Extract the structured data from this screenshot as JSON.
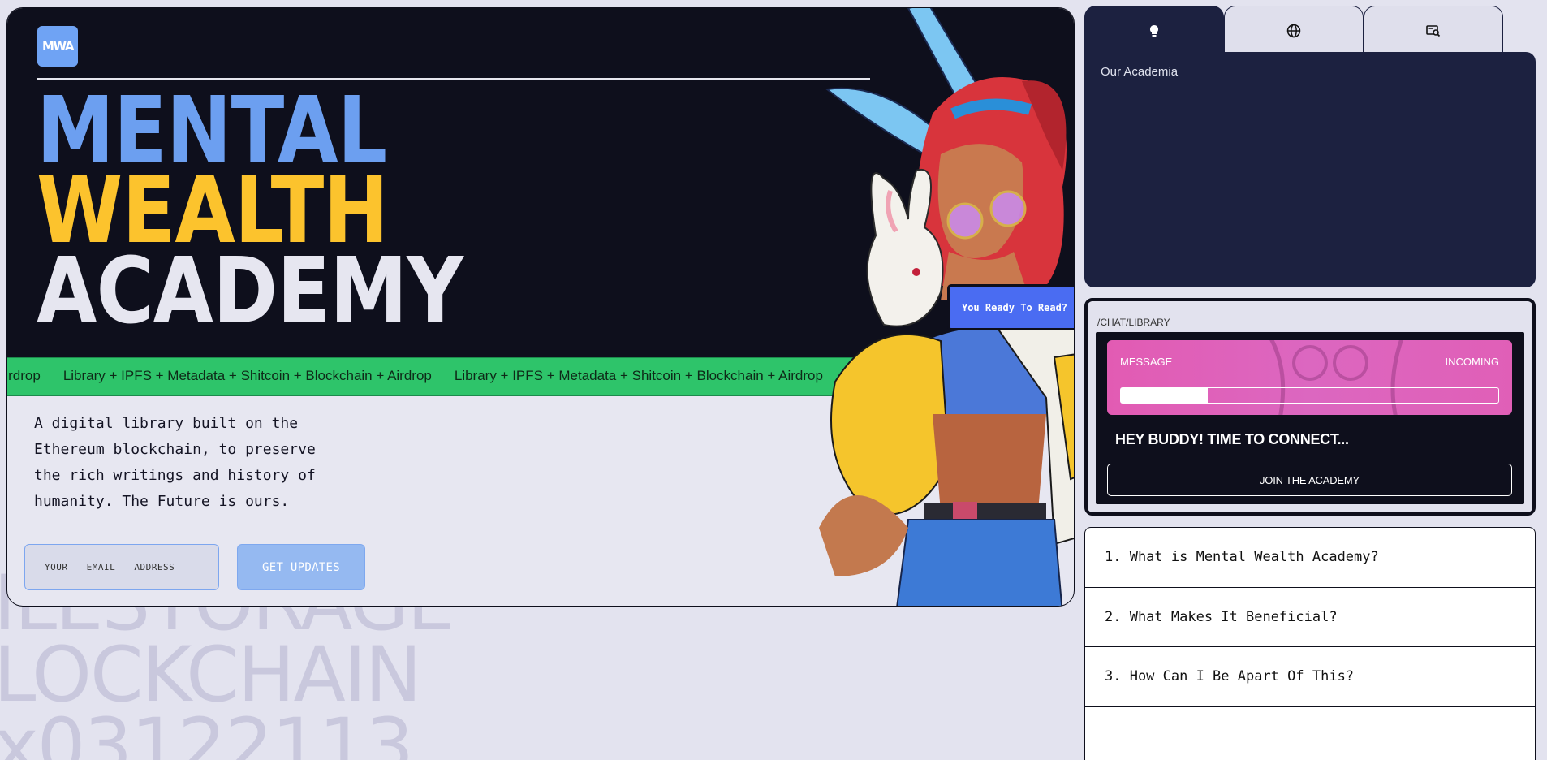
{
  "background_words": [
    "ILESTORAGE",
    "LOCKCHAIN",
    "x03122113"
  ],
  "hero": {
    "logo": "MWA",
    "title_line1": "MENTAL",
    "title_line2": "WEALTH",
    "title_line3": "ACADEMY",
    "ticker_items": [
      "Airdrop",
      "Library + IPFS + Metadata + Shitcoin + Blockchain + Airdrop",
      "Library + IPFS + Metadata + Shitcoin + Blockchain + Airdrop"
    ],
    "description": "A digital library built on the Ethereum blockchain, to preserve the rich writings and history of humanity. The Future is ours.",
    "email_placeholder": "YOUR EMAIL ADDRESS",
    "updates_label": "GET UPDATES",
    "bubble_label": "You Ready To Read?"
  },
  "tabs": [
    {
      "icon": "lightbulb-icon",
      "active": true
    },
    {
      "icon": "globe-icon",
      "active": false
    },
    {
      "icon": "search-document-icon",
      "active": false
    }
  ],
  "panel": {
    "title": "Our Academia"
  },
  "chat": {
    "path": "/CHAT/LIBRARY",
    "message_label": "MESSAGE",
    "incoming_label": "INCOMING",
    "progress": 0.23,
    "headline": "HEY BUDDY! TIME TO CONNECT...",
    "join_label": "JOIN THE ACADEMY"
  },
  "faq": [
    "1. What is Mental Wealth Academy?",
    "2. What Makes It Beneficial?",
    "3. How Can I Be Apart Of This?"
  ]
}
